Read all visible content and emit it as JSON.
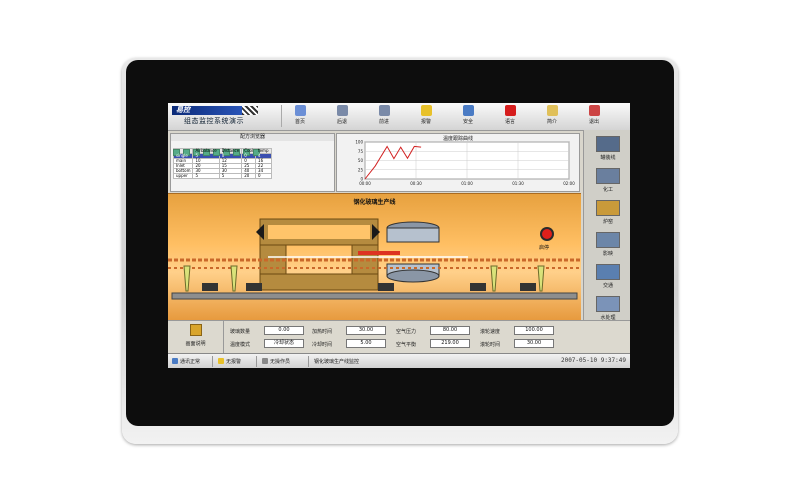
{
  "header": {
    "logo_text": "易控",
    "subtitle": "组态监控系统演示"
  },
  "toolbar": {
    "items": [
      {
        "label": "首页",
        "icon": "home-icon",
        "color": "#6b8fd6"
      },
      {
        "label": "后退",
        "icon": "back-icon",
        "color": "#7a8aa8"
      },
      {
        "label": "前进",
        "icon": "forward-icon",
        "color": "#7a8aa8"
      },
      {
        "label": "报警",
        "icon": "alarm-bell-icon",
        "color": "#e8c12a"
      },
      {
        "label": "安全",
        "icon": "security-users-icon",
        "color": "#4a7bc4"
      },
      {
        "label": "语言",
        "icon": "language-flag-icon",
        "color": "#d61d1d"
      },
      {
        "label": "简介",
        "icon": "intro-icon",
        "color": "#e0c05a"
      },
      {
        "label": "退出",
        "icon": "exit-icon",
        "color": "#c44"
      }
    ]
  },
  "recipe": {
    "title": "配方浏览器",
    "columns": [
      "",
      "Airbalance",
      "Distance",
      "Cool",
      "temp"
    ],
    "rows": [
      [
        "single",
        "5",
        "0",
        "0",
        "4"
      ],
      [
        "main",
        "10",
        "12",
        "0",
        "16"
      ],
      [
        "Inlet",
        "20",
        "15",
        "25",
        "22"
      ],
      [
        "bottom",
        "30",
        "30",
        "40",
        "34"
      ],
      [
        "upper",
        "5",
        "5",
        "20",
        "0"
      ]
    ],
    "selected_row": 0
  },
  "trend": {
    "title": "温度跟踪曲线"
  },
  "chart_data": {
    "type": "line",
    "title": "温度跟踪曲线",
    "xlabel": "",
    "ylabel": "",
    "x_ticks": [
      "00:00",
      "00:30",
      "01:00",
      "01:30",
      "02:00"
    ],
    "y_ticks": [
      0,
      25,
      50,
      75,
      100
    ],
    "ylim": [
      0,
      100
    ],
    "grid": true,
    "x_minutes": [
      0,
      6,
      13,
      17,
      21,
      25,
      29,
      33
    ],
    "values": [
      0,
      35,
      88,
      55,
      86,
      56,
      88,
      86
    ],
    "color": "#d22222"
  },
  "process": {
    "title": "钢化玻璃生产线",
    "start_stop_label": "启停"
  },
  "nav": {
    "items": [
      {
        "label": "罐装线",
        "icon": "filling-line-icon"
      },
      {
        "label": "化工",
        "icon": "chemical-icon"
      },
      {
        "label": "炉窑",
        "icon": "furnace-icon"
      },
      {
        "label": "影映",
        "icon": "video-icon"
      },
      {
        "label": "交通",
        "icon": "traffic-icon"
      },
      {
        "label": "水处理",
        "icon": "water-treatment-icon"
      }
    ]
  },
  "params": {
    "desc_label": "画面说明",
    "row1": [
      {
        "label": "玻璃数量",
        "value": "0.00"
      },
      {
        "label": "加热时间",
        "value": "30.00"
      },
      {
        "label": "空气压力",
        "value": "80.00"
      },
      {
        "label": "滚轮速度",
        "value": "100.00"
      }
    ],
    "row2": [
      {
        "label": "温度模式",
        "value": "冷却状态"
      },
      {
        "label": "冷却时间",
        "value": "5.00"
      },
      {
        "label": "空气平衡",
        "value": "219.00"
      },
      {
        "label": "滚轮时间",
        "value": "30.00"
      }
    ]
  },
  "status": {
    "comm": "通讯正常",
    "alarm": "无报警",
    "op": "无操作员",
    "screen": "钢化玻璃生产线监控",
    "clock": "2007-05-10  9:37:49"
  }
}
